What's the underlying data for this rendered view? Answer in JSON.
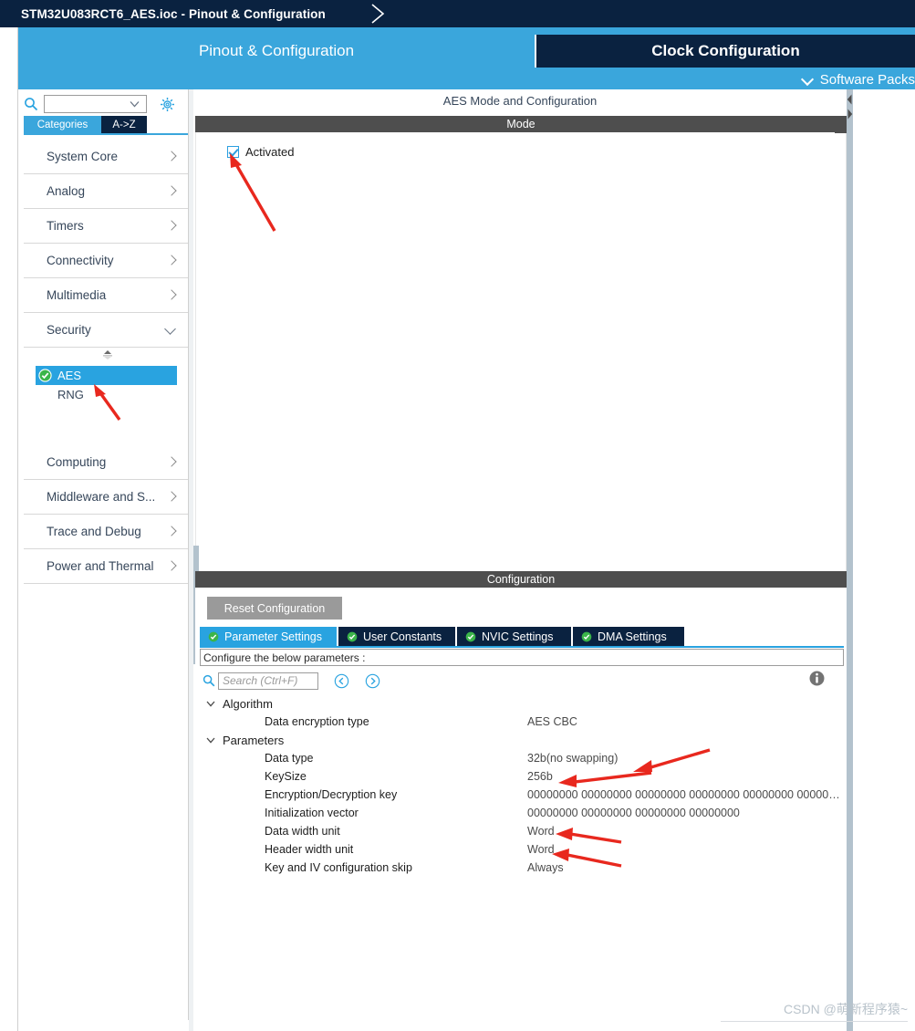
{
  "titlebar": {
    "title": "STM32U083RCT6_AES.ioc - Pinout & Configuration"
  },
  "tabs": {
    "pinout": "Pinout & Configuration",
    "clock": "Clock Configuration",
    "software_packs": "Software Packs",
    "chevron_icon": "chevron-down-icon"
  },
  "left_panel": {
    "search": {
      "value": "",
      "placeholder": "",
      "icon": "search-icon"
    },
    "gear_icon": "gear-icon",
    "view_tabs": [
      {
        "label": "Categories",
        "active": true
      },
      {
        "label": "A->Z",
        "active": false
      }
    ],
    "categories": [
      {
        "label": "System Core",
        "expanded": false
      },
      {
        "label": "Analog",
        "expanded": false
      },
      {
        "label": "Timers",
        "expanded": false
      },
      {
        "label": "Connectivity",
        "expanded": false
      },
      {
        "label": "Multimedia",
        "expanded": false
      },
      {
        "label": "Security",
        "expanded": true
      }
    ],
    "security_items": [
      {
        "label": "AES",
        "selected": true,
        "checked": true
      },
      {
        "label": "RNG",
        "selected": false,
        "checked": false
      }
    ],
    "categories_after": [
      {
        "label": "Computing",
        "expanded": false
      },
      {
        "label": "Middleware and S...",
        "expanded": false
      },
      {
        "label": "Trace and Debug",
        "expanded": false
      },
      {
        "label": "Power and Thermal",
        "expanded": false
      }
    ]
  },
  "main": {
    "heading": "AES Mode and Configuration",
    "mode": {
      "bar_label": "Mode",
      "activated": {
        "label": "Activated",
        "checked": true
      }
    },
    "configuration": {
      "bar_label": "Configuration",
      "reset_button": "Reset Configuration",
      "tabs": [
        {
          "label": "Parameter Settings",
          "active": true
        },
        {
          "label": "User Constants",
          "active": false
        },
        {
          "label": "NVIC Settings",
          "active": false
        },
        {
          "label": "DMA Settings",
          "active": false
        }
      ],
      "configure_note": "Configure the below parameters :",
      "param_search": {
        "placeholder": "Search (Ctrl+F)",
        "value": ""
      },
      "nav_prev_icon": "circle-left-arrow-icon",
      "nav_next_icon": "circle-right-arrow-icon",
      "info_icon": "info-icon",
      "groups": [
        {
          "name": "Algorithm",
          "expanded": true,
          "rows": [
            {
              "key": "Data encryption type",
              "value": "AES CBC"
            }
          ]
        },
        {
          "name": "Parameters",
          "expanded": true,
          "rows": [
            {
              "key": "Data type",
              "value": "32b(no swapping)"
            },
            {
              "key": "KeySize",
              "value": "256b"
            },
            {
              "key": "Encryption/Decryption key",
              "value": "00000000 00000000 00000000 00000000 00000000 00000…"
            },
            {
              "key": "Initialization vector",
              "value": "00000000 00000000 00000000 00000000"
            },
            {
              "key": "Data width unit",
              "value": "Word"
            },
            {
              "key": "Header width unit",
              "value": "Word"
            },
            {
              "key": "Key and IV configuration skip",
              "value": "Always"
            }
          ]
        }
      ]
    }
  },
  "watermark": "CSDN @萌新程序猿~",
  "colors": {
    "brand_dark": "#0a2240",
    "brand_blue": "#3aa6dc",
    "accent_blue": "#29a3e0",
    "bar_gray": "#4e4e4e",
    "annotation_red": "#e8281e"
  }
}
